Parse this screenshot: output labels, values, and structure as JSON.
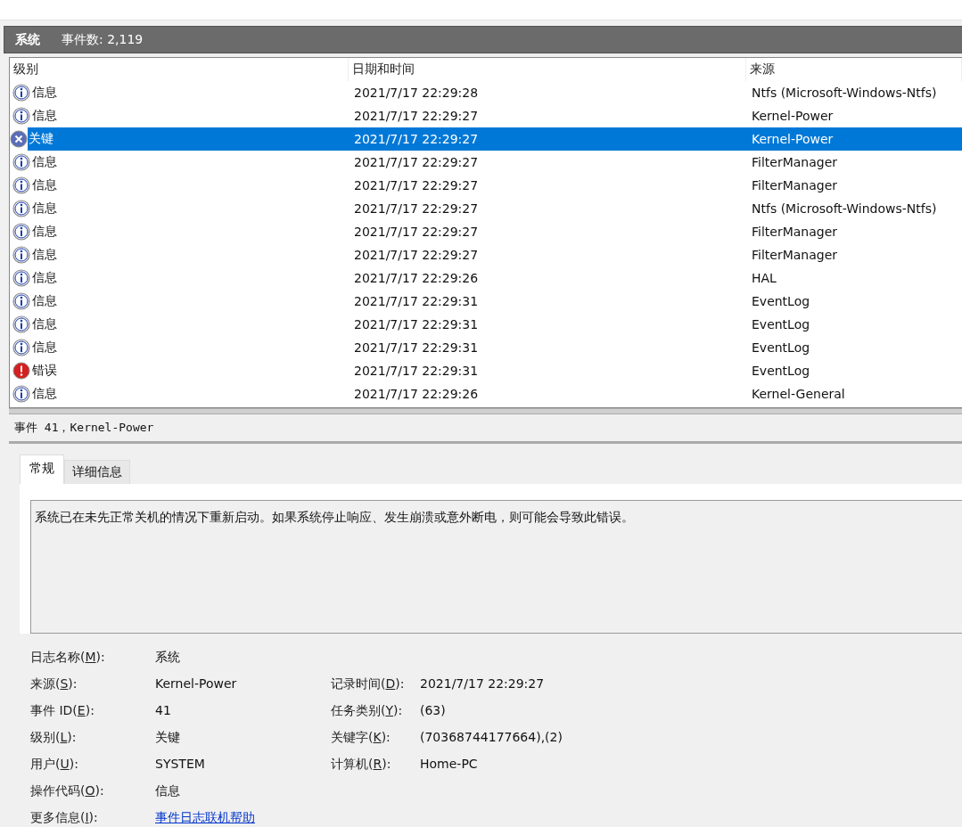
{
  "header": {
    "log_name": "系统",
    "event_count": "事件数: 2,119"
  },
  "table": {
    "columns": [
      "级别",
      "日期和时间",
      "来源"
    ],
    "rows": [
      {
        "kind": "info",
        "level": "信息",
        "datetime": "2021/7/17 22:29:28",
        "source": "Ntfs (Microsoft-Windows-Ntfs)",
        "selected": false
      },
      {
        "kind": "info",
        "level": "信息",
        "datetime": "2021/7/17 22:29:27",
        "source": "Kernel-Power",
        "selected": false
      },
      {
        "kind": "critical",
        "level": "关键",
        "datetime": "2021/7/17 22:29:27",
        "source": "Kernel-Power",
        "selected": true
      },
      {
        "kind": "info",
        "level": "信息",
        "datetime": "2021/7/17 22:29:27",
        "source": "FilterManager",
        "selected": false
      },
      {
        "kind": "info",
        "level": "信息",
        "datetime": "2021/7/17 22:29:27",
        "source": "FilterManager",
        "selected": false
      },
      {
        "kind": "info",
        "level": "信息",
        "datetime": "2021/7/17 22:29:27",
        "source": "Ntfs (Microsoft-Windows-Ntfs)",
        "selected": false
      },
      {
        "kind": "info",
        "level": "信息",
        "datetime": "2021/7/17 22:29:27",
        "source": "FilterManager",
        "selected": false
      },
      {
        "kind": "info",
        "level": "信息",
        "datetime": "2021/7/17 22:29:27",
        "source": "FilterManager",
        "selected": false
      },
      {
        "kind": "info",
        "level": "信息",
        "datetime": "2021/7/17 22:29:26",
        "source": "HAL",
        "selected": false
      },
      {
        "kind": "info",
        "level": "信息",
        "datetime": "2021/7/17 22:29:31",
        "source": "EventLog",
        "selected": false
      },
      {
        "kind": "info",
        "level": "信息",
        "datetime": "2021/7/17 22:29:31",
        "source": "EventLog",
        "selected": false
      },
      {
        "kind": "info",
        "level": "信息",
        "datetime": "2021/7/17 22:29:31",
        "source": "EventLog",
        "selected": false
      },
      {
        "kind": "error",
        "level": "错误",
        "datetime": "2021/7/17 22:29:31",
        "source": "EventLog",
        "selected": false
      },
      {
        "kind": "info",
        "level": "信息",
        "datetime": "2021/7/17 22:29:26",
        "source": "Kernel-General",
        "selected": false
      }
    ]
  },
  "detail": {
    "title": "事件 41，Kernel-Power",
    "tabs": [
      {
        "label": "常规",
        "selected": true
      },
      {
        "label": "详细信息",
        "selected": false
      }
    ],
    "message": "系统已在未先正常关机的情况下重新启动。如果系统停止响应、发生崩溃或意外断电，则可能会导致此错误。",
    "fields": [
      {
        "label": "日志名称(",
        "key": "M",
        "rest": "):",
        "value": "系统"
      },
      {
        "label": "来源(",
        "key": "S",
        "rest": "):",
        "value": "Kernel-Power"
      },
      {
        "label": "记录时间(",
        "key": "D",
        "rest": "):",
        "value": "2021/7/17 22:29:27"
      },
      {
        "label": "事件 ID(",
        "key": "E",
        "rest": "):",
        "value": "41"
      },
      {
        "label": "任务类别(",
        "key": "Y",
        "rest": "):",
        "value": "(63)"
      },
      {
        "label": "级别(",
        "key": "L",
        "rest": "):",
        "value": "关键"
      },
      {
        "label": "关键字(",
        "key": "K",
        "rest": "):",
        "value": "(70368744177664),(2)"
      },
      {
        "label": "用户(",
        "key": "U",
        "rest": "):",
        "value": "SYSTEM"
      },
      {
        "label": "计算机(",
        "key": "R",
        "rest": "):",
        "value": "Home-PC"
      },
      {
        "label": "操作代码(",
        "key": "O",
        "rest": "):",
        "value": "信息"
      },
      {
        "label": "更多信息(",
        "key": "I",
        "rest": "):",
        "value": "事件日志联机帮助",
        "kind": "link"
      }
    ]
  }
}
